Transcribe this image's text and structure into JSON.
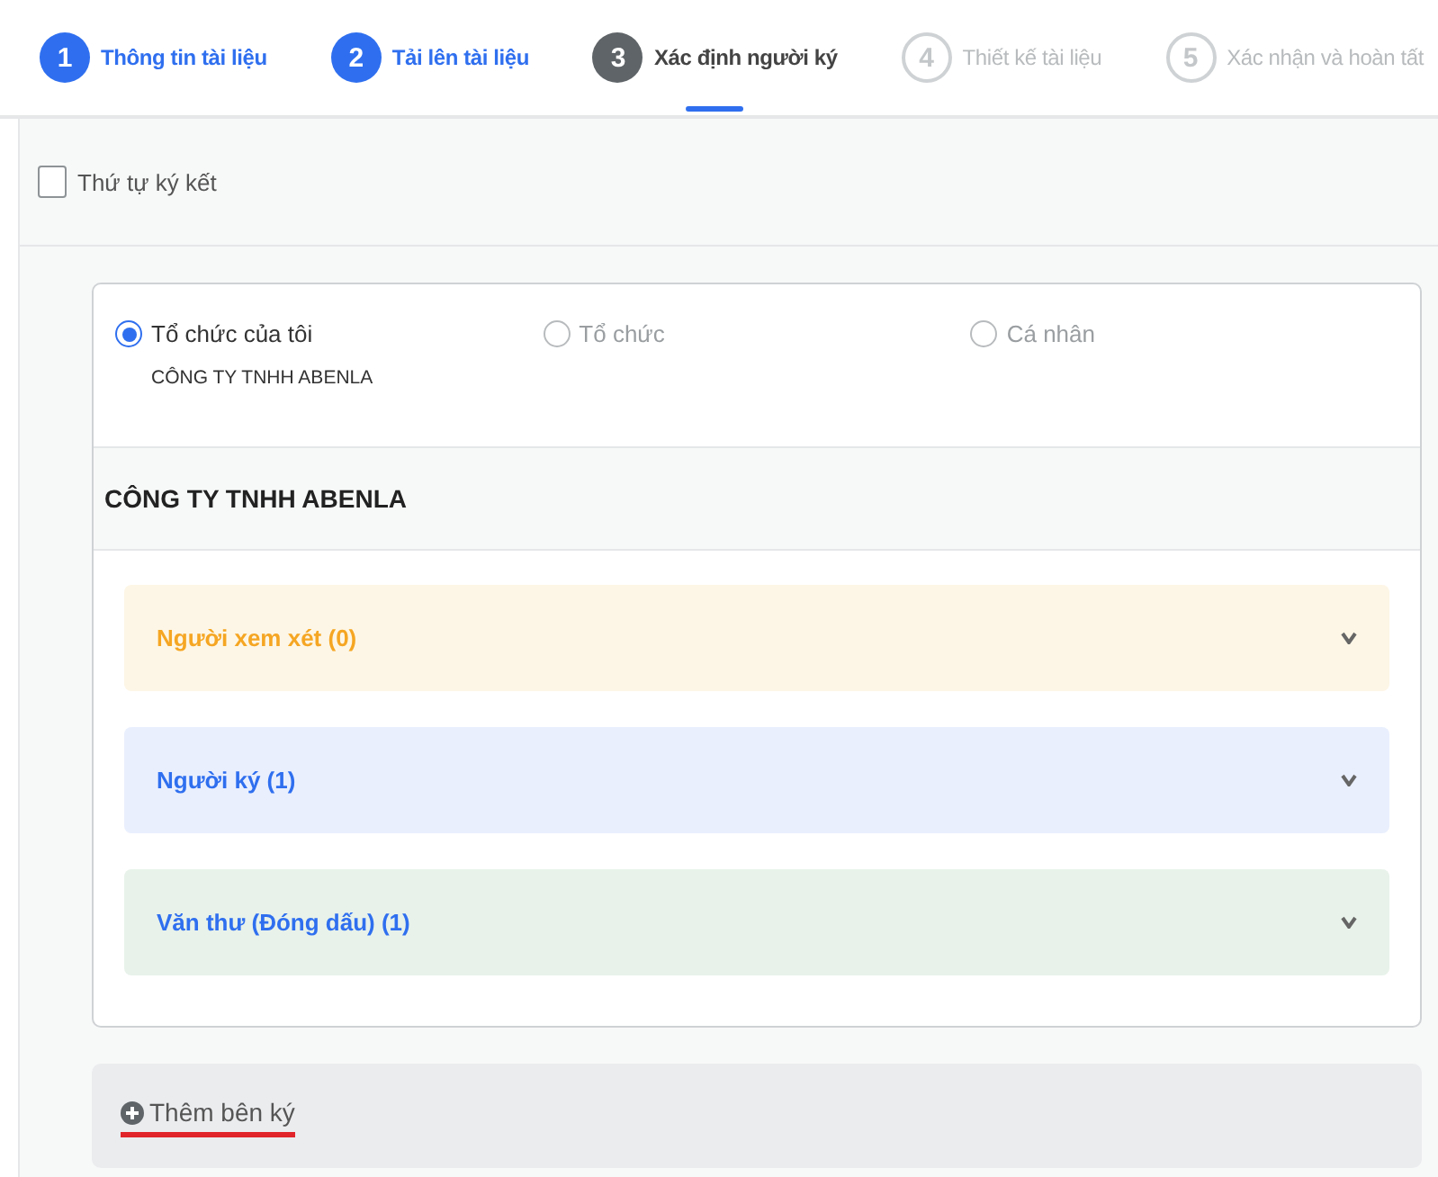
{
  "steps": [
    {
      "number": "1",
      "label": "Thông tin tài liệu",
      "completed": true,
      "selected": false
    },
    {
      "number": "2",
      "label": "Tải lên tài liệu",
      "completed": true,
      "selected": false
    },
    {
      "number": "3",
      "label": "Xác định người ký",
      "completed": false,
      "selected": true
    },
    {
      "number": "4",
      "label": "Thiết kế tài liệu",
      "completed": false,
      "selected": false
    },
    {
      "number": "5",
      "label": "Xác nhận và hoàn tất",
      "completed": false,
      "selected": false
    }
  ],
  "signing_order": {
    "label": "Thứ tự ký kết",
    "checked": false
  },
  "party_card": {
    "options": [
      {
        "label": "Tổ chức của tôi",
        "selected": true,
        "sublabel": "CÔNG TY TNHH ABENLA"
      },
      {
        "label": "Tổ chức",
        "selected": false
      },
      {
        "label": "Cá nhân",
        "selected": false
      }
    ],
    "organization": "CÔNG TY TNHH ABENLA",
    "groups": [
      {
        "label": "Người xem xét (0)",
        "color": "#f5a623",
        "expanded": false
      },
      {
        "label": "Người ký (1)",
        "color": "#2f6fef",
        "expanded": false
      },
      {
        "label": "Văn thư (Đóng dấu) (1)",
        "color": "#2f6fef",
        "expanded": false
      }
    ]
  },
  "add_party": {
    "label": "Thêm bên ký",
    "underlined": true
  }
}
